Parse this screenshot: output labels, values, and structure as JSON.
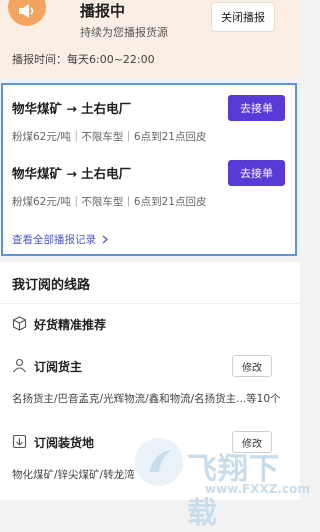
{
  "broadcast": {
    "title": "播报中",
    "subtitle": "持续为您播报货源",
    "time": "播报时间：每天6:00~22:00",
    "close_label": "关闭播报"
  },
  "orders": [
    {
      "route": "物华煤矿 → 土右电厂",
      "detail": "粉煤62元/吨｜不限车型｜6点到21点回皮",
      "button": "去接单"
    },
    {
      "route": "物华煤矿 → 土右电厂",
      "detail": "粉煤62元/吨｜不限车型｜6点到21点回皮",
      "button": "去接单"
    }
  ],
  "view_all": {
    "label": "查看全部播报记录"
  },
  "routes": {
    "title": "我订阅的线路",
    "recommend_label": "好货精准推荐",
    "consignor": {
      "label": "订阅货主",
      "edit_label": "修改",
      "list": "名扬货主/巴音孟克/光辉物流/鑫和物流/名扬货主...等10个"
    },
    "loading": {
      "label": "订阅装货地",
      "edit_label": "修改",
      "list": "物化煤矿/锌尖煤矿/转龙湾"
    }
  },
  "watermark": {
    "text": "飞翔下载",
    "url": "www.FXXZ.com"
  },
  "colors": {
    "accent": "#5a3ad6",
    "highlight_border": "#5c95df",
    "broadcast_bg": "#fbeee4",
    "badge": "#f3a55f"
  }
}
